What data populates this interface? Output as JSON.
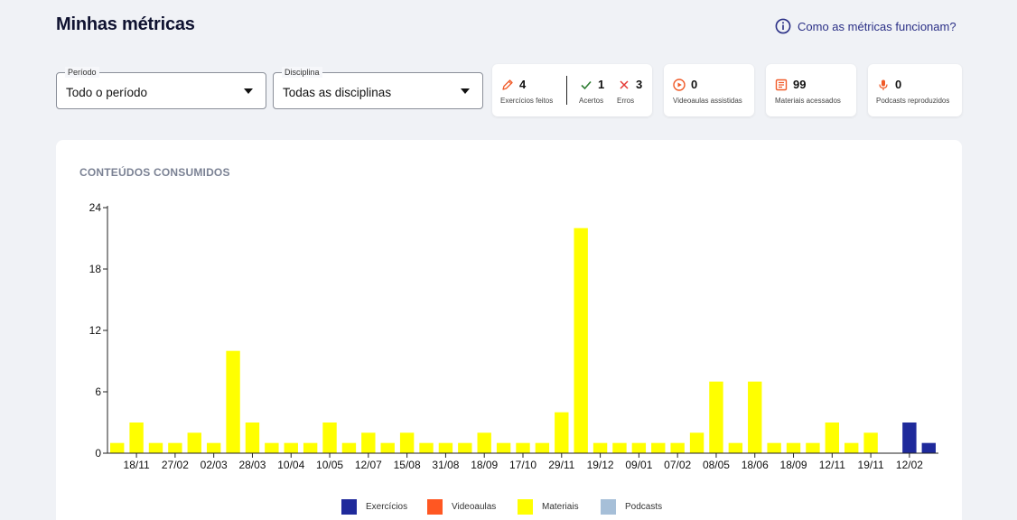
{
  "header": {
    "title": "Minhas métricas",
    "help_label": "Como as métricas funcionam?"
  },
  "filters": {
    "period": {
      "legend": "Período",
      "value": "Todo o período"
    },
    "discipline": {
      "legend": "Disciplina",
      "value": "Todas as disciplinas"
    }
  },
  "metrics": {
    "exercises": {
      "value": "4",
      "label": "Exercícios feitos",
      "icon": "pencil-icon"
    },
    "correct": {
      "value": "1",
      "label": "Acertos",
      "icon": "check-icon"
    },
    "errors": {
      "value": "3",
      "label": "Erros",
      "icon": "x-icon"
    },
    "videos": {
      "value": "0",
      "label": "Videoaulas assistidas",
      "icon": "play-circle-icon"
    },
    "materials": {
      "value": "99",
      "label": "Materiais acessados",
      "icon": "book-icon"
    },
    "podcasts": {
      "value": "0",
      "label": "Podcasts reproduzidos",
      "icon": "microphone-icon"
    }
  },
  "colors": {
    "accent": "#2a2f86",
    "orange": "#f05a28",
    "exercises": "#1f2a9b",
    "videos": "#ff5722",
    "materials": "#ffff00",
    "podcasts": "#a6bfd8"
  },
  "chart_data": {
    "type": "bar",
    "title": "CONTEÚDOS CONSUMIDOS",
    "ylim": [
      0,
      24
    ],
    "yticks": [
      0,
      6,
      12,
      18,
      24
    ],
    "tick_labels": [
      "18/11",
      "27/02",
      "02/03",
      "28/03",
      "10/04",
      "10/05",
      "12/07",
      "15/08",
      "31/08",
      "18/09",
      "17/10",
      "29/11",
      "19/12",
      "09/01",
      "07/02",
      "08/05",
      "18/06",
      "18/09",
      "12/11",
      "19/11",
      "12/02"
    ],
    "legend": [
      "Exercícios",
      "Videoaulas",
      "Materiais",
      "Podcasts"
    ],
    "series": [
      {
        "name": "Exercícios",
        "values": [
          0,
          0,
          0,
          0,
          0,
          0,
          0,
          0,
          0,
          0,
          0,
          0,
          0,
          0,
          0,
          0,
          0,
          0,
          0,
          0,
          0,
          0,
          0,
          0,
          0,
          0,
          0,
          0,
          0,
          0,
          0,
          0,
          0,
          0,
          0,
          0,
          0,
          0,
          0,
          0,
          0,
          3,
          1
        ]
      },
      {
        "name": "Videoaulas",
        "values": [
          0,
          0,
          0,
          0,
          0,
          0,
          0,
          0,
          0,
          0,
          0,
          0,
          0,
          0,
          0,
          0,
          0,
          0,
          0,
          0,
          0,
          0,
          0,
          0,
          0,
          0,
          0,
          0,
          0,
          0,
          0,
          0,
          0,
          0,
          0,
          0,
          0,
          0,
          0,
          0,
          0,
          0,
          0
        ]
      },
      {
        "name": "Materiais",
        "values": [
          1,
          3,
          1,
          1,
          2,
          1,
          10,
          3,
          1,
          1,
          1,
          3,
          1,
          2,
          1,
          2,
          1,
          1,
          1,
          2,
          1,
          1,
          1,
          4,
          22,
          1,
          1,
          1,
          1,
          1,
          2,
          7,
          1,
          7,
          1,
          1,
          1,
          3,
          1,
          2,
          0,
          0,
          0
        ]
      },
      {
        "name": "Podcasts",
        "values": [
          0,
          0,
          0,
          0,
          0,
          0,
          0,
          0,
          0,
          0,
          0,
          0,
          0,
          0,
          0,
          0,
          0,
          0,
          0,
          0,
          0,
          0,
          0,
          0,
          0,
          0,
          0,
          0,
          0,
          0,
          0,
          0,
          0,
          0,
          0,
          0,
          0,
          0,
          0,
          0,
          0,
          0,
          0
        ]
      }
    ]
  }
}
